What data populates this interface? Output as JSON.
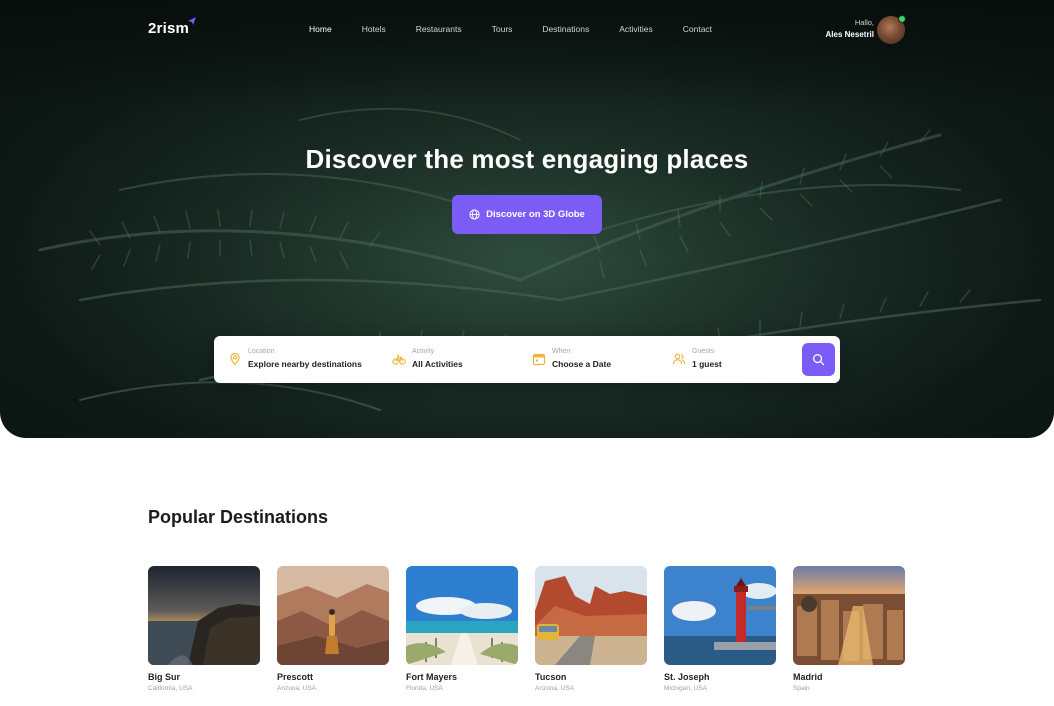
{
  "brand": {
    "name": "2rism"
  },
  "nav": {
    "items": [
      {
        "label": "Home",
        "active": true
      },
      {
        "label": "Hotels",
        "active": false
      },
      {
        "label": "Restaurants",
        "active": false
      },
      {
        "label": "Tours",
        "active": false
      },
      {
        "label": "Destinations",
        "active": false
      },
      {
        "label": "Activities",
        "active": false
      },
      {
        "label": "Contact",
        "active": false
      }
    ]
  },
  "user": {
    "greeting": "Hallo,",
    "name": "Ales Nesetril",
    "online_color": "#37d46b"
  },
  "hero": {
    "title": "Discover the most engaging places",
    "cta_label": "Discover on 3D Globe",
    "cta_icon": "globe-icon"
  },
  "search": {
    "fields": [
      {
        "label": "Location",
        "value": "Explore nearby destinations",
        "icon": "map-pin-icon"
      },
      {
        "label": "Activity",
        "value": "All Activities",
        "icon": "bicycle-icon"
      },
      {
        "label": "When",
        "value": "Choose a Date",
        "icon": "calendar-icon"
      },
      {
        "label": "Guests",
        "value": "1 guest",
        "icon": "users-icon"
      }
    ],
    "button_icon": "search-icon"
  },
  "popular": {
    "title": "Popular Destinations",
    "items": [
      {
        "name": "Big Sur",
        "location": "California, USA"
      },
      {
        "name": "Prescott",
        "location": "Arizona, USA"
      },
      {
        "name": "Fort Mayers",
        "location": "Florida, USA"
      },
      {
        "name": "Tucson",
        "location": "Arizona, USA"
      },
      {
        "name": "St. Joseph",
        "location": "Michigan, USA"
      },
      {
        "name": "Madrid",
        "location": "Spain"
      }
    ]
  },
  "colors": {
    "accent": "#7c5cf6",
    "icon_accent": "#f0b43a",
    "hero_dark": "#0f1b17"
  }
}
